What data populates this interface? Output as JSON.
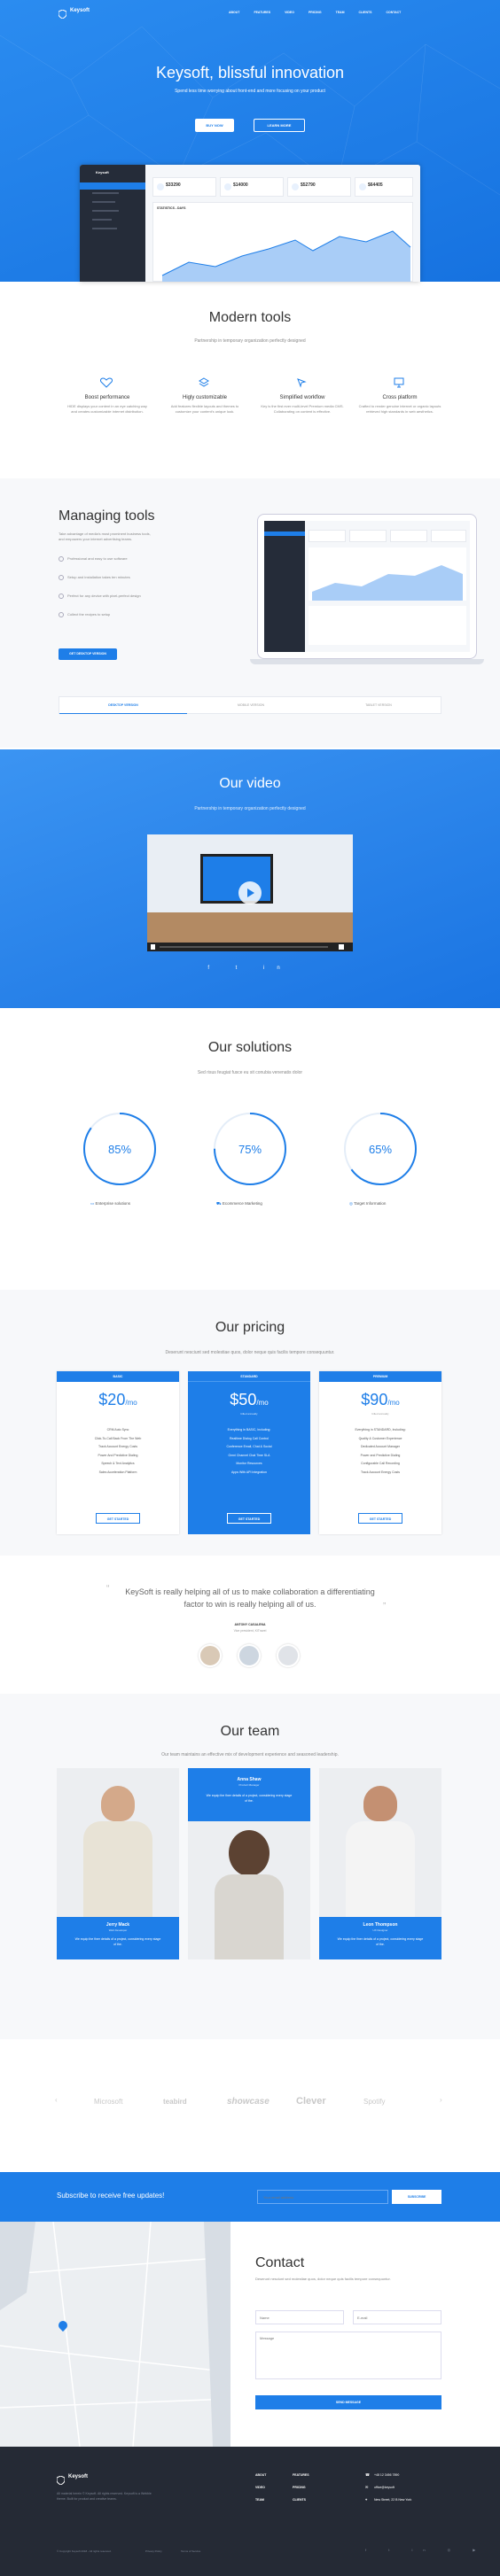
{
  "brand": "Keysoft",
  "nav": [
    "ABOUT",
    "FEATURES",
    "VIDEO",
    "PRICING",
    "TEAM",
    "CLIENTS",
    "CONTACT"
  ],
  "hero": {
    "title": "Keysoft, blissful innovation",
    "subtitle": "Spend less time worrying about front-end and more focusing on your product",
    "btn1": "BUY NOW",
    "btn2": "LEARN MORE"
  },
  "dash": {
    "stats": [
      "$33290",
      "$14000",
      "$52790",
      "$64405"
    ],
    "chart_title": "STATISTICS - DAYS"
  },
  "tools": {
    "title": "Modern tools",
    "subtitle": "Partnership in temporary organization perfectly designed",
    "items": [
      {
        "title": "Boost performance",
        "text": "HIDE displays your content in an eye catching way and creates customizable internet distribution."
      },
      {
        "title": "Higly customizable",
        "text": "Add features flexible layouts and themes to customize your content's unique look."
      },
      {
        "title": "Simplified workflow",
        "text": "Key is the first ever multi-level Premium media CMS. Collaborating on content is effective."
      },
      {
        "title": "Cross platform",
        "text": "Crafted to render genuine internet or organic layouts retrieved high standards in web aesthetics."
      }
    ]
  },
  "managing": {
    "title": "Managing tools",
    "text": "Take advantage of media's most prominent business tools, and empowers your internet advertising teams.",
    "checks": [
      "Professional and easy to use software",
      "Setup and installation takes ten minutes",
      "Perfect for any device with pixel-perfect design",
      "Collect the recipes to setup"
    ],
    "btn": "GET DESKTOP VERSION",
    "tabs": [
      "DESKTOP VERSION",
      "MOBILE VERSION",
      "TABLET VERSION"
    ]
  },
  "video": {
    "title": "Our video",
    "subtitle": "Partnership in temporary organization perfectly designed"
  },
  "solutions": {
    "title": "Our solutions",
    "subtitle": "Sed risus feugiat fusce eu sit conubia venenatis dolor",
    "items": [
      {
        "pct": "85%",
        "label": "Enterprise solutions"
      },
      {
        "pct": "75%",
        "label": "Ecommerce Marketing"
      },
      {
        "pct": "65%",
        "label": "Target Information"
      }
    ]
  },
  "pricing": {
    "title": "Our pricing",
    "subtitle": "Deserunt nesciunt sed molestiae quos, dolor neque quis facilis tempore consequuntur.",
    "plans": [
      {
        "name": "BASIC",
        "price": "$20",
        "per": "/mo",
        "note": "",
        "features": [
          "CRM Auto Sync",
          "Click-To-Call Back From The Web",
          "Track Account Energy Costs",
          "Power And Predictive Dialing",
          "Speech & Text Analytics",
          "Sales Acceleration Platform"
        ],
        "btn": "GET STARTED"
      },
      {
        "name": "STANDARD",
        "price": "$50",
        "per": "/mo",
        "note": "billed annually",
        "features": [
          "Everything in BASIC, Including:",
          "Realtime Dialog Call Control",
          "Conference Email, Chat & Social",
          "Omni Channel Chat Time SLA",
          "Monitor Resources",
          "Apps With API Integration"
        ],
        "btn": "GET STARTED"
      },
      {
        "name": "PREMIUM",
        "price": "$90",
        "per": "/mo",
        "note": "billed annually",
        "features": [
          "Everything in STANDARD, Including:",
          "Quality & Customer Experience",
          "Dedicated Account Manager",
          "Power and Predictive Dialing",
          "Configurable Call Recording",
          "Track Account Energy Costs"
        ],
        "btn": "GET STARTED"
      }
    ]
  },
  "testimonial": {
    "quote": "KeySoft is really helping all of us to make collaboration a differentiating factor to win is really helping all of us.",
    "name": "ANTONY CASALENA",
    "role": "Vice president, KiTravel"
  },
  "team": {
    "title": "Our team",
    "subtitle": "Our team maintains an effective mix of development experience and seasoned leadership.",
    "members": [
      {
        "name": "Jerry Mack",
        "role": "Web Developer",
        "text": "We equip the finer details of a project, considering every stage of the."
      },
      {
        "name": "Anna Shaw",
        "role": "Product Manager",
        "text": "We equip the finer details of a project, considering every stage of the."
      },
      {
        "name": "Leon Thompson",
        "role": "UX Designer",
        "text": "We equip the finer details of a project, considering every stage of the."
      }
    ]
  },
  "clients": [
    "Microsoft",
    "teabird",
    "showcase",
    "Clever",
    "Spotify"
  ],
  "subscribe": {
    "label": "Subscribe to receive free updates!",
    "placeholder": "Your email address",
    "btn": "SUBSCRIBE"
  },
  "contact": {
    "title": "Contact",
    "text": "Deserunt nesciunt sed molestiae quos, dolor neque quis facilis tempore consequuntur.",
    "name": "Name",
    "email": "E-mail",
    "message": "Message",
    "btn": "SEND MESSAGE"
  },
  "footer": {
    "text": "All material herein © Keysoft. All rights reserved. Keysoft is a Webble theme. Built for product and creative teams.",
    "links": [
      "ABOUT",
      "FEATURES",
      "VIDEO",
      "PRICING",
      "TEAM",
      "CLIENTS"
    ],
    "phone": "+48 12 3456 7890",
    "email": "office@keysoft",
    "address": "New Street, 22 B New York",
    "copy": "© Copyright Keysoft 2018 - All rights reserved.",
    "legal": [
      "Privacy Policy",
      "Terms of Service"
    ]
  }
}
